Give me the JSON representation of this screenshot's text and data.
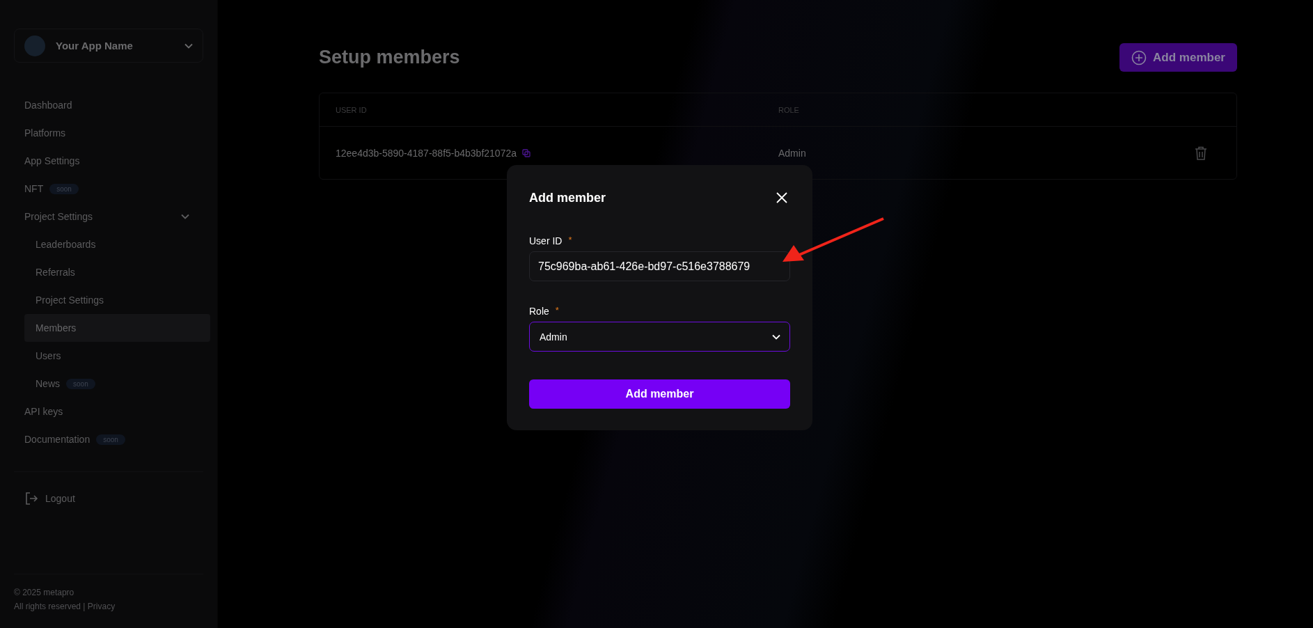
{
  "sidebar": {
    "app_name": "Your App Name",
    "nav": [
      {
        "label": "Dashboard",
        "selected": false
      },
      {
        "label": "Platforms",
        "selected": false
      },
      {
        "label": "App Settings",
        "selected": false
      },
      {
        "label": "NFT",
        "selected": false,
        "badge": "soon"
      },
      {
        "label": "Project Settings",
        "selected": false,
        "expanded": true,
        "children": [
          {
            "label": "Leaderboards",
            "selected": false
          },
          {
            "label": "Referrals",
            "selected": false
          },
          {
            "label": "Project Settings",
            "selected": false
          },
          {
            "label": "Members",
            "selected": true
          },
          {
            "label": "Users",
            "selected": false
          },
          {
            "label": "News",
            "selected": false,
            "badge": "soon"
          }
        ]
      },
      {
        "label": "API keys",
        "selected": false
      },
      {
        "label": "Documentation",
        "selected": false,
        "badge": "soon"
      }
    ],
    "logout": "Logout",
    "footer": {
      "copyright": "© 2025 metapro",
      "rights": "All rights reserved |",
      "privacy": "Privacy"
    }
  },
  "main": {
    "title": "Setup members",
    "add_button": "Add member",
    "table": {
      "columns": [
        "USER ID",
        "ROLE"
      ],
      "rows": [
        {
          "user_id": "12ee4d3b-5890-4187-88f5-b4b3bf21072a",
          "role": "Admin"
        }
      ]
    }
  },
  "dialog": {
    "title": "Add member",
    "fields": [
      {
        "kind": "text",
        "label": "User ID",
        "required_mark": "*",
        "value": "75c969ba-ab61-426e-bd97-c516e3788679",
        "focused": false
      },
      {
        "kind": "select",
        "label": "Role",
        "required_mark": "*",
        "value": "Admin",
        "focused": true
      }
    ],
    "submit": "Add member"
  }
}
